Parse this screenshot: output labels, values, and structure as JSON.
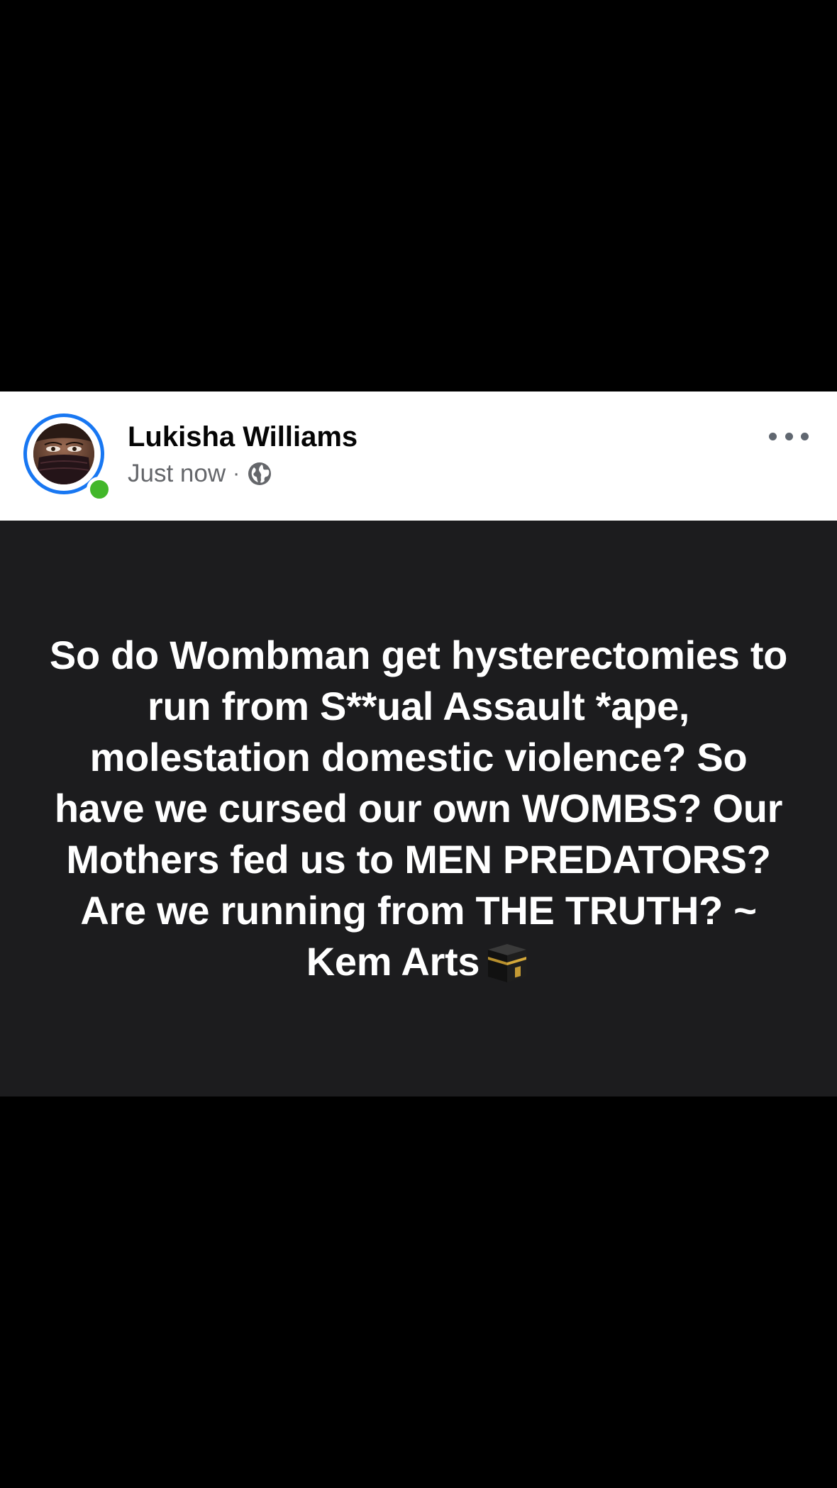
{
  "post": {
    "author_name": "Lukisha Williams",
    "timestamp": "Just now",
    "separator": "·",
    "privacy_icon": "globe-icon",
    "more_icon": "more-dots-icon",
    "online_status_color": "#42b72a",
    "avatar_ring_color": "#1877f2",
    "body_text": "So do Wombman get hysterectomies to run from S**ual Assault *ape, molestation domestic violence? So have we cursed our own WOMBS? Our Mothers fed us to MEN PREDATORS? Are we running from THE TRUTH?  ~ Kem Arts",
    "body_emoji_icon": "kaaba-emoji-icon",
    "body_background": "#1c1c1e",
    "body_text_color": "#ffffff"
  }
}
